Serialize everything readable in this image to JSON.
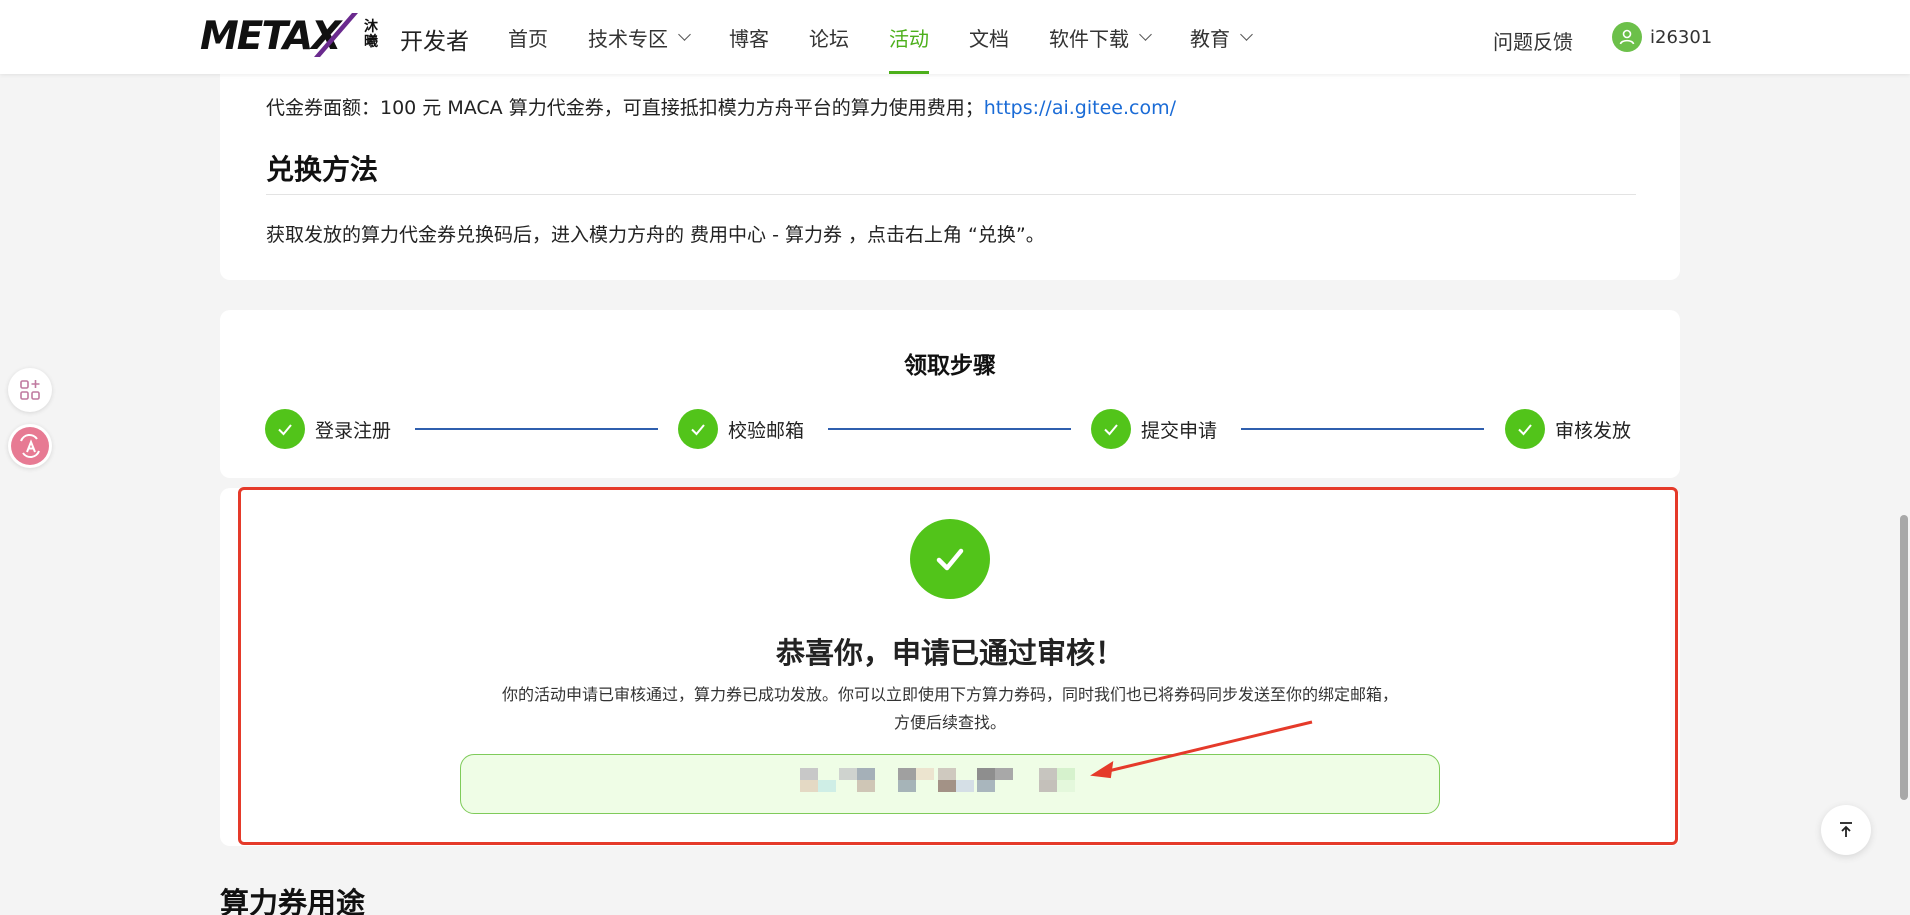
{
  "header": {
    "logo_text": "METAX",
    "logo_cn": "沐曦",
    "dev_label": "开发者",
    "nav": [
      {
        "label": "首页",
        "dropdown": false,
        "active": false
      },
      {
        "label": "技术专区",
        "dropdown": true,
        "active": false
      },
      {
        "label": "博客",
        "dropdown": false,
        "active": false
      },
      {
        "label": "论坛",
        "dropdown": false,
        "active": false
      },
      {
        "label": "活动",
        "dropdown": false,
        "active": true
      },
      {
        "label": "文档",
        "dropdown": false,
        "active": false
      },
      {
        "label": "软件下载",
        "dropdown": true,
        "active": false
      },
      {
        "label": "教育",
        "dropdown": true,
        "active": false
      }
    ],
    "feedback": "问题反馈",
    "username": "i26301"
  },
  "voucher": {
    "text": "代金券面额：100 元 MACA 算力代金券，可直接抵扣模力方舟平台的算力使用费用；",
    "link": "https://ai.gitee.com/"
  },
  "redeem": {
    "title": "兑换方法",
    "text": "获取发放的算力代金券兑换码后，进入模力方舟的 费用中心 - 算力券 ，点击右上角 “兑换”。"
  },
  "steps": {
    "title": "领取步骤",
    "items": [
      "登录注册",
      "校验邮箱",
      "提交申请",
      "审核发放"
    ]
  },
  "success": {
    "title": "恭喜你，申请已通过审核！",
    "desc_line1": "你的活动申请已审核通过，算力券已成功发放。你可以立即使用下方算力券码，同时我们也已将券码同步发送至你的绑定邮箱，",
    "desc_line2": "方便后续查找。"
  },
  "usage_title": "算力券用途",
  "colors": {
    "accent_green": "#52c41a",
    "nav_active": "#4caf1b",
    "link": "#1a6bd6",
    "highlight_border": "#e53a2a",
    "step_line": "#2f5fae"
  },
  "icons": [
    "user-avatar-icon",
    "check-icon",
    "apps-icon",
    "translate-icon",
    "back-to-top-icon",
    "chevron-down-icon"
  ]
}
